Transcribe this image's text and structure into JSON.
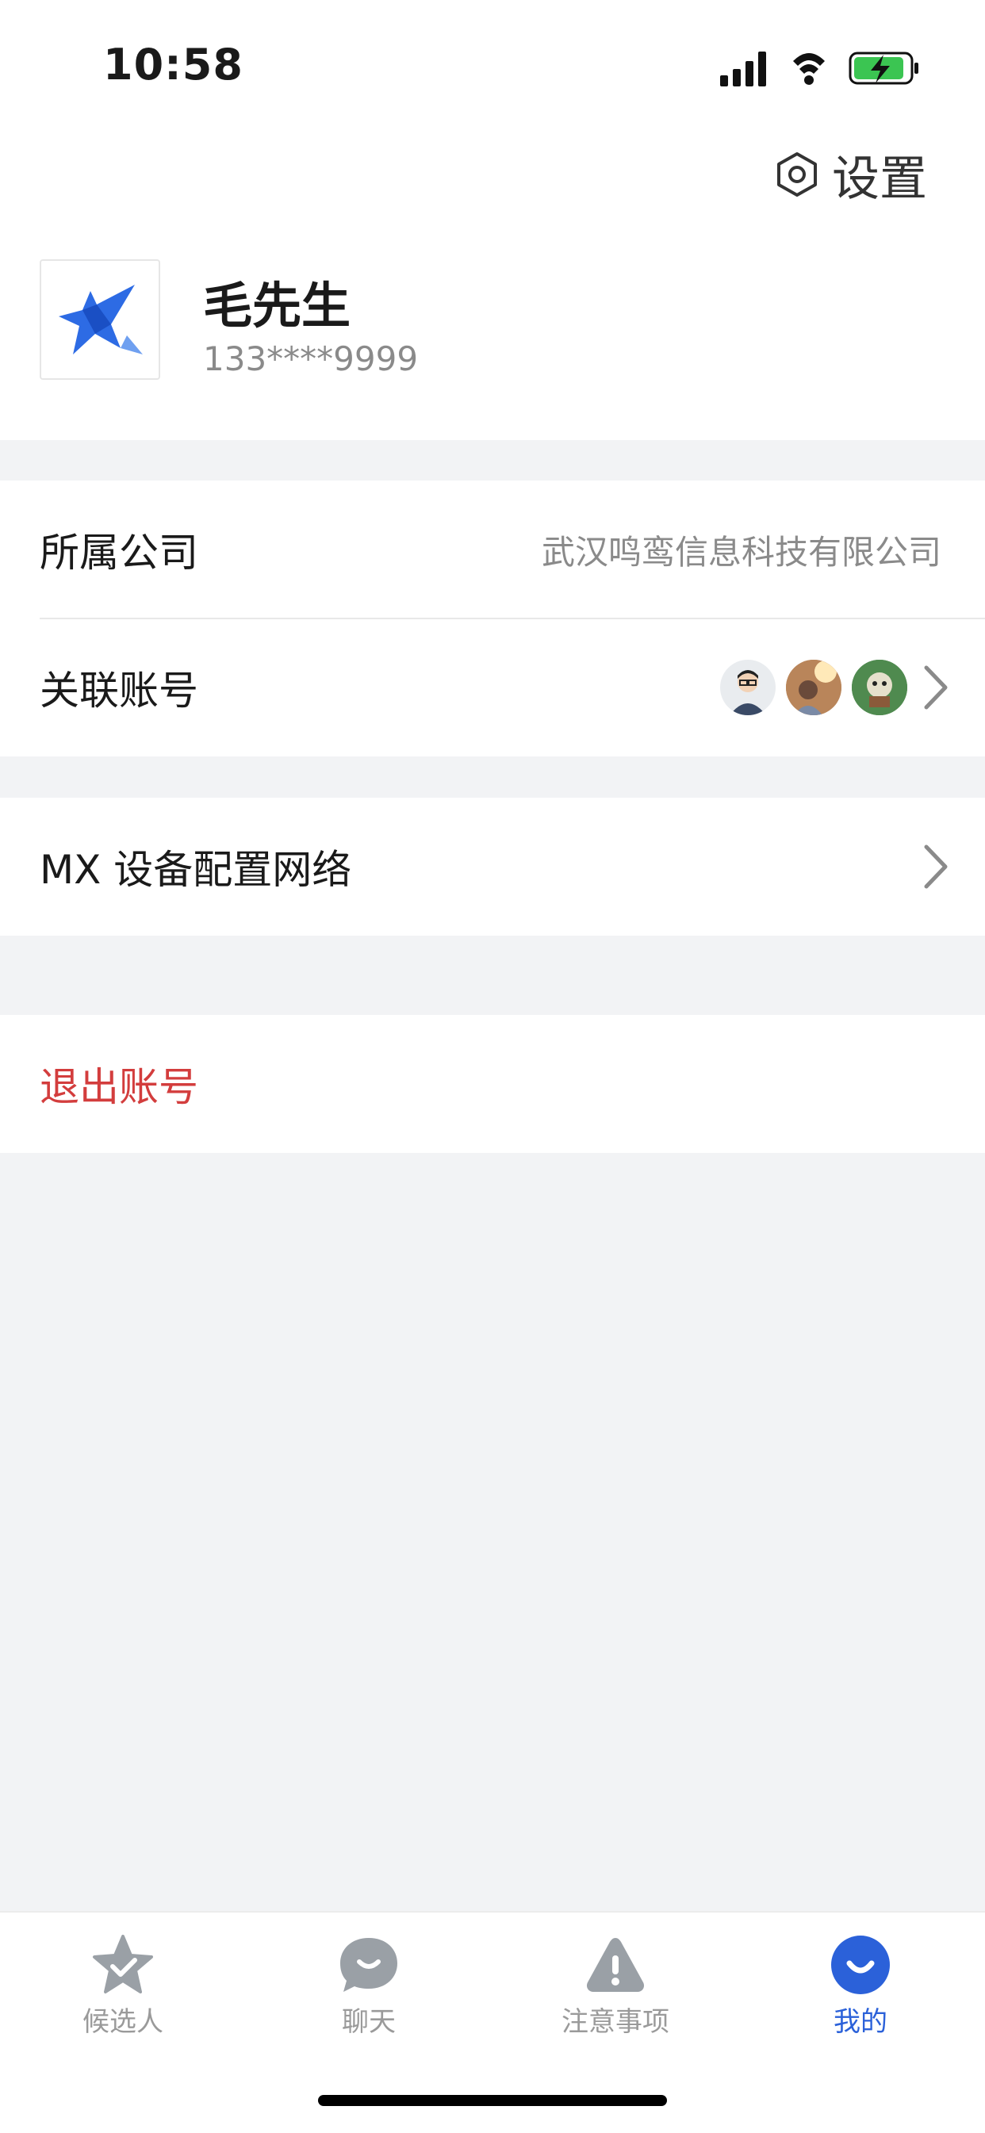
{
  "status_bar": {
    "time": "10:58"
  },
  "header": {
    "settings_label": "设置",
    "user_name": "毛先生",
    "user_phone": "133****9999"
  },
  "profile": {
    "company_label": "所属公司",
    "company_value": "武汉鸣鸾信息科技有限公司",
    "linked_accounts_label": "关联账号"
  },
  "menu": {
    "mx_network_label": "MX 设备配置网络"
  },
  "actions": {
    "logout_label": "退出账号"
  },
  "tabbar": {
    "tabs": [
      {
        "label": "候选人",
        "icon": "star-check-icon"
      },
      {
        "label": "聊天",
        "icon": "chat-bubble-icon"
      },
      {
        "label": "注意事项",
        "icon": "warning-icon"
      },
      {
        "label": "我的",
        "icon": "profile-smile-icon",
        "active": true
      }
    ]
  },
  "colors": {
    "accent": "#2b61d9",
    "danger": "#d33d3d",
    "muted": "#8a8a8a"
  }
}
